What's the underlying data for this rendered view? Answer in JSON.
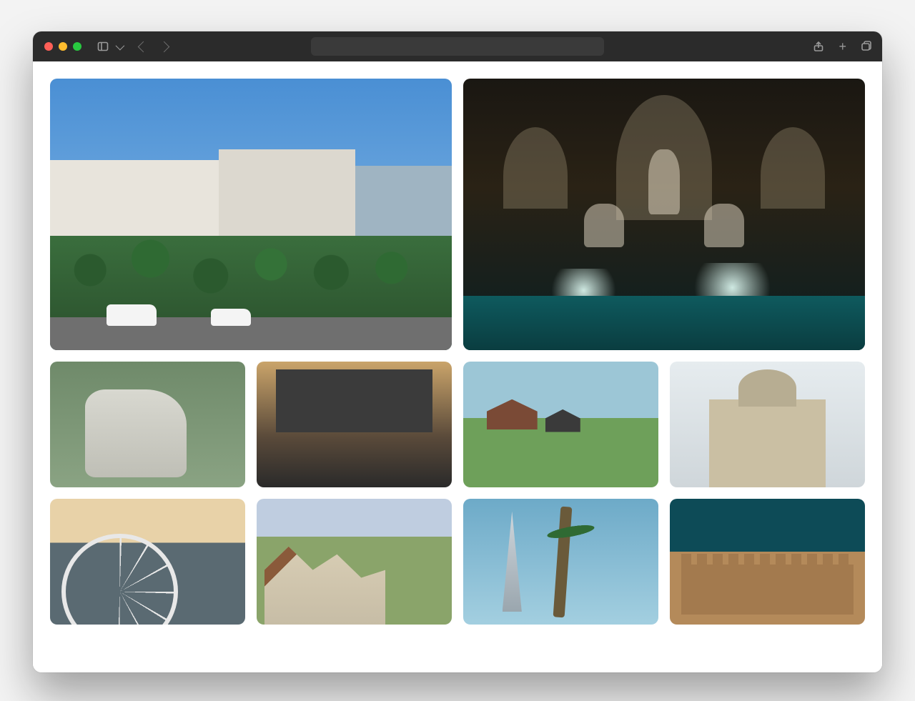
{
  "browser": {
    "address_bar_value": "",
    "toolbar": {
      "sidebar_icon": "sidebar-icon",
      "dropdown_icon": "chevron-down-icon",
      "back_icon": "back-icon",
      "forward_icon": "forward-icon",
      "share_icon": "share-icon",
      "new_tab_icon": "plus-icon",
      "tabs_icon": "tab-overview-icon"
    }
  },
  "gallery": {
    "rows": [
      {
        "kind": "large",
        "items": [
          {
            "name": "photo-street-palms",
            "alt": "Street with palm trees and white buildings under blue sky"
          },
          {
            "name": "photo-trevi-fountain",
            "alt": "Baroque fountain with statues lit at night"
          }
        ]
      },
      {
        "kind": "small",
        "items": [
          {
            "name": "photo-park-statue",
            "alt": "White stone statue among green trees"
          },
          {
            "name": "photo-evening-street",
            "alt": "Wide street and historic building at dusk"
          },
          {
            "name": "photo-countryside-houses",
            "alt": "Small houses by water in green fields"
          },
          {
            "name": "photo-domed-cathedral",
            "alt": "Neoclassical building with large dome"
          }
        ]
      },
      {
        "kind": "small",
        "items": [
          {
            "name": "photo-city-ferris-wheel",
            "alt": "Aerial city view with ferris wheel at sunset"
          },
          {
            "name": "photo-hillside-village",
            "alt": "Cottages on a hill with countryside behind"
          },
          {
            "name": "photo-skyscraper-palms",
            "alt": "Tall tower behind palm trees against blue sky"
          },
          {
            "name": "photo-desert-fortress",
            "alt": "Sandstone fortress walls under teal sky"
          }
        ]
      }
    ]
  }
}
